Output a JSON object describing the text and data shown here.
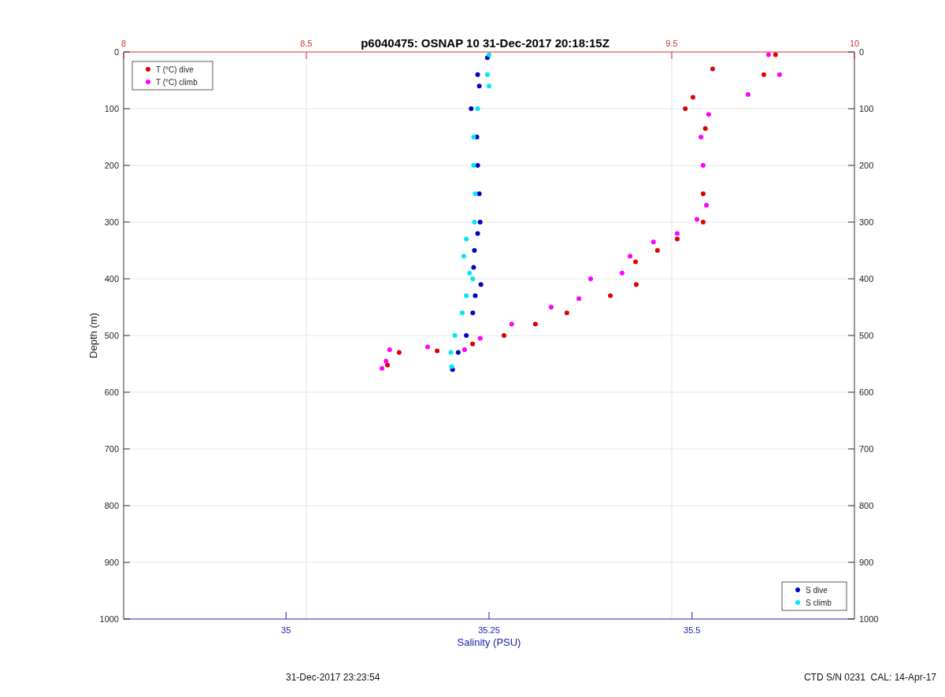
{
  "plot": {
    "title": "p6040475: OSNAP 10 31-Dec-2017 20:18:15Z",
    "chart_data": {
      "type": "scatter",
      "grid": true,
      "legend": [
        "upper left",
        "lower right"
      ],
      "xlabel": "Salinity (PSU)",
      "ylabel": "Depth (m)",
      "xlim": [
        34.8,
        35.7
      ],
      "ylim": [
        1000,
        0
      ],
      "xticks": [
        35,
        35.25,
        35.5
      ],
      "yticks": [
        0,
        100,
        200,
        300,
        400,
        500,
        600,
        700,
        800,
        900,
        1000
      ],
      "x2lim": [
        8,
        10
      ],
      "x2ticks": [
        8,
        8.5,
        9.5,
        10
      ],
      "y2lim": [
        1000,
        0
      ],
      "y2ticks": [
        0,
        100,
        200,
        300,
        400,
        500,
        600,
        700,
        800,
        900,
        1000
      ],
      "series": [
        {
          "name": "T (°C) dive",
          "color": "#e00000",
          "axis": "x2",
          "x": [
            9.784,
            9.752,
            9.612,
            9.558,
            9.537,
            9.592,
            9.586,
            9.586,
            9.515,
            9.461,
            9.401,
            9.403,
            9.332,
            9.213,
            9.127,
            9.041,
            8.955,
            8.858,
            8.754,
            8.722
          ],
          "values": [
            5,
            40,
            30,
            80,
            100,
            135,
            250,
            300,
            330,
            350,
            370,
            410,
            430,
            460,
            480,
            500,
            515,
            527,
            530,
            552
          ]
        },
        {
          "name": "T (°C) climb",
          "color": "#ff00ff",
          "axis": "x2",
          "x": [
            9.765,
            9.795,
            9.709,
            9.601,
            9.58,
            9.586,
            9.595,
            9.569,
            9.515,
            9.45,
            9.386,
            9.364,
            9.278,
            9.246,
            9.17,
            9.062,
            8.976,
            8.933,
            8.832,
            8.728,
            8.718,
            8.707
          ],
          "values": [
            5,
            40,
            75,
            110,
            150,
            200,
            270,
            295,
            320,
            335,
            360,
            390,
            400,
            435,
            450,
            480,
            505,
            525,
            520,
            525,
            545,
            558
          ]
        },
        {
          "name": "S dive",
          "color": "#0000c8",
          "x": [
            35.248,
            35.236,
            35.238,
            35.228,
            35.235,
            35.236,
            35.238,
            35.239,
            35.236,
            35.232,
            35.231,
            35.24,
            35.233,
            35.23,
            35.222,
            35.212,
            35.205
          ],
          "values": [
            10,
            40,
            60,
            100,
            150,
            200,
            250,
            300,
            320,
            350,
            380,
            410,
            430,
            460,
            500,
            530,
            560
          ]
        },
        {
          "name": "S climb",
          "color": "#00e8f0",
          "x": [
            35.25,
            35.248,
            35.25,
            35.236,
            35.231,
            35.231,
            35.233,
            35.232,
            35.222,
            35.219,
            35.226,
            35.23,
            35.222,
            35.217,
            35.208,
            35.203,
            35.204
          ],
          "values": [
            5,
            40,
            60,
            100,
            150,
            200,
            250,
            300,
            330,
            360,
            390,
            400,
            430,
            460,
            500,
            530,
            555
          ]
        }
      ]
    }
  },
  "footer": {
    "left": "31-Dec-2017 23:23:54",
    "right": "CTD S/N 0231  CAL: 14-Apr-17"
  }
}
